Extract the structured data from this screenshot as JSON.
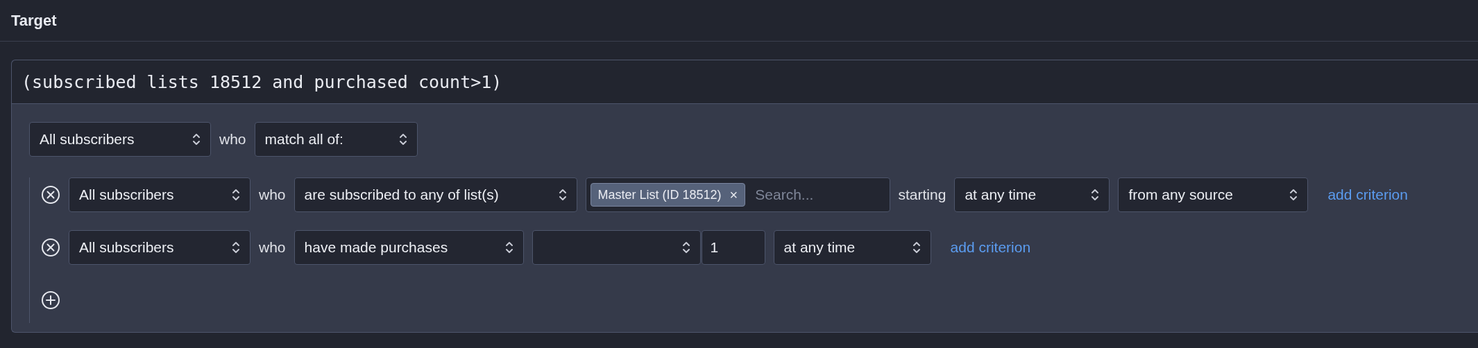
{
  "title": "Target",
  "expression": "(subscribed lists 18512 and purchased count>1)",
  "root": [
    {
      "kind": "select",
      "value": "All subscribers"
    },
    {
      "kind": "text",
      "text": "who"
    },
    {
      "kind": "select",
      "value": "match all of:"
    }
  ],
  "criteria": [
    {
      "parts": [
        {
          "kind": "select",
          "value": "All subscribers"
        },
        {
          "kind": "text",
          "text": "who"
        },
        {
          "kind": "select",
          "value": "are subscribed to any of list(s)"
        },
        {
          "kind": "tags",
          "tags": [
            {
              "label": "Master List (ID 18512)",
              "remove": "×"
            }
          ],
          "placeholder": "Search..."
        },
        {
          "kind": "text",
          "text": "starting"
        },
        {
          "kind": "select",
          "value": "at any time"
        },
        {
          "kind": "select",
          "value": "from any source"
        },
        {
          "kind": "link",
          "text": "add criterion"
        }
      ]
    },
    {
      "parts": [
        {
          "kind": "select",
          "value": "All subscribers"
        },
        {
          "kind": "text",
          "text": "who"
        },
        {
          "kind": "select",
          "value": "have made purchases"
        },
        {
          "kind": "select"
        },
        {
          "kind": "input",
          "value": "1"
        },
        {
          "kind": "select",
          "value": "at any time"
        },
        {
          "kind": "link",
          "text": "add criterion"
        }
      ]
    }
  ]
}
